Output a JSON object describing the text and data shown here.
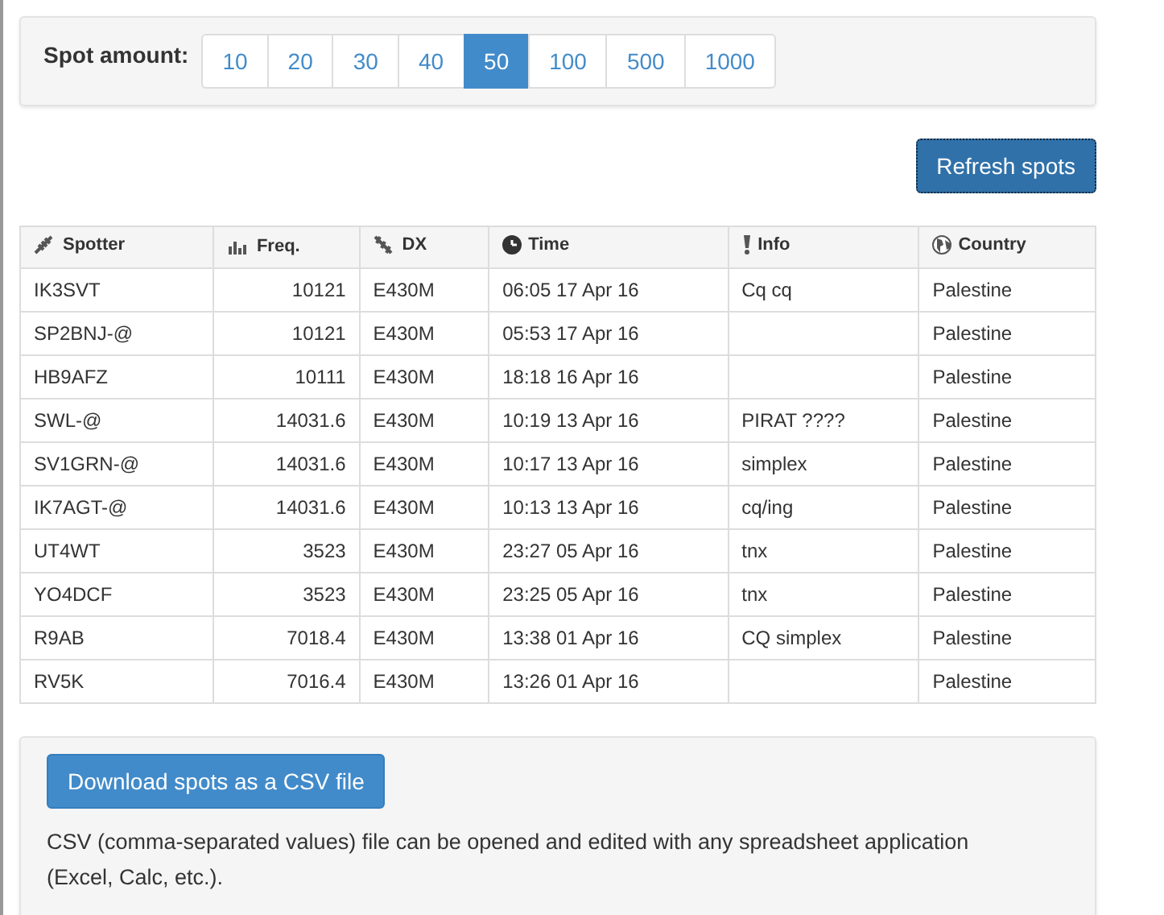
{
  "spot_amount": {
    "label": "Spot amount:",
    "options": [
      {
        "label": "10",
        "selected": false
      },
      {
        "label": "20",
        "selected": false
      },
      {
        "label": "30",
        "selected": false
      },
      {
        "label": "40",
        "selected": false
      },
      {
        "label": "50",
        "selected": true
      },
      {
        "label": "100",
        "selected": false
      },
      {
        "label": "500",
        "selected": false
      },
      {
        "label": "1000",
        "selected": false
      }
    ]
  },
  "refresh_button": "Refresh spots",
  "table": {
    "columns": [
      "Spotter",
      "Freq.",
      "DX",
      "Time",
      "Info",
      "Country"
    ],
    "rows": [
      [
        "IK3SVT",
        "10121",
        "E430M",
        "06:05 17 Apr 16",
        "Cq cq",
        "Palestine"
      ],
      [
        "SP2BNJ-@",
        "10121",
        "E430M",
        "05:53 17 Apr 16",
        "",
        "Palestine"
      ],
      [
        "HB9AFZ",
        "10111",
        "E430M",
        "18:18 16 Apr 16",
        "",
        "Palestine"
      ],
      [
        "SWL-@",
        "14031.6",
        "E430M",
        "10:19 13 Apr 16",
        "PIRAT ????",
        "Palestine"
      ],
      [
        "SV1GRN-@",
        "14031.6",
        "E430M",
        "10:17 13 Apr 16",
        "simplex",
        "Palestine"
      ],
      [
        "IK7AGT-@",
        "14031.6",
        "E430M",
        "10:13 13 Apr 16",
        "cq/ing",
        "Palestine"
      ],
      [
        "UT4WT",
        "3523",
        "E430M",
        "23:27 05 Apr 16",
        "tnx",
        "Palestine"
      ],
      [
        "YO4DCF",
        "3523",
        "E430M",
        "23:25 05 Apr 16",
        "tnx",
        "Palestine"
      ],
      [
        "R9AB",
        "7018.4",
        "E430M",
        "13:38 01 Apr 16",
        "CQ simplex",
        "Palestine"
      ],
      [
        "RV5K",
        "7016.4",
        "E430M",
        "13:26 01 Apr 16",
        "",
        "Palestine"
      ]
    ]
  },
  "download": {
    "button": "Download spots as a CSV file",
    "note": "CSV (comma-separated values) file can be opened and edited with any spreadsheet application (Excel, Calc, etc.)."
  }
}
